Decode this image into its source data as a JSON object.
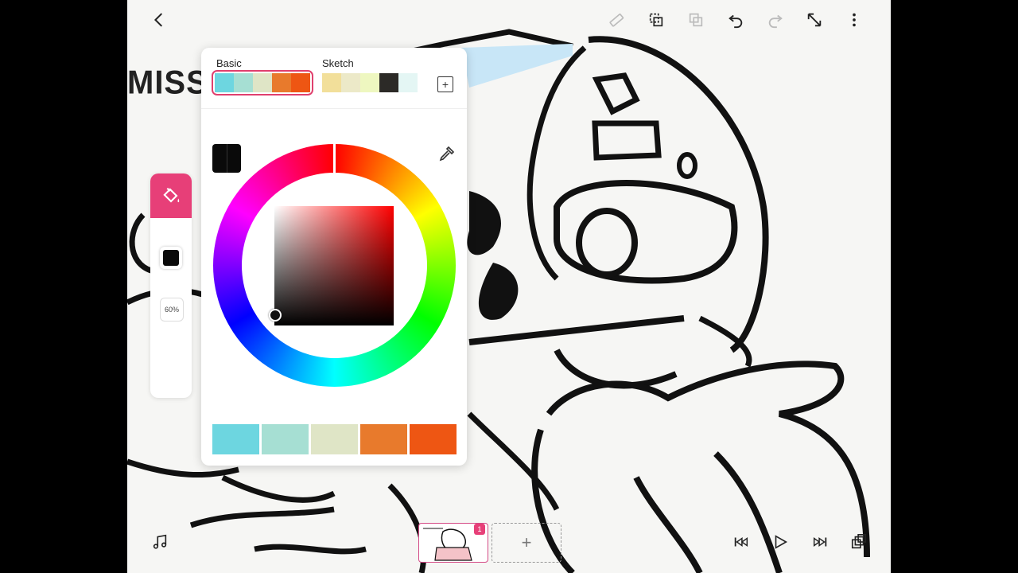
{
  "canvas": {
    "header_text": "MISS"
  },
  "palette_panel": {
    "palettes": [
      {
        "name": "Basic",
        "swatches": [
          "#6dd6e0",
          "#a6dfd3",
          "#dfe5c6",
          "#e87a2c",
          "#ee5613"
        ],
        "selected": true
      },
      {
        "name": "Sketch",
        "swatches": [
          "#f2df9a",
          "#ece9c8",
          "#eef7c0",
          "#2c2a27",
          "#e4f6f4"
        ],
        "selected": false
      }
    ],
    "add_palette_label": "+",
    "current_color": "#0a0a0a",
    "hue": "#ff0000",
    "recent_colors": [
      "#6dd6e0",
      "#a6dfd3",
      "#dfe5c6",
      "#e87a2c",
      "#ee5613"
    ]
  },
  "side_tool": {
    "tool_icon": "paint-bucket-icon",
    "accent": "#e73f78",
    "color": "#0a0a0a",
    "opacity_label": "60%"
  },
  "timeline": {
    "frame_badge": "1",
    "add_frame_label": "+"
  },
  "toolbar": {
    "icons": [
      "back-icon",
      "ruler-icon",
      "copy-icon",
      "paste-icon",
      "undo-icon",
      "redo-icon",
      "expand-icon",
      "more-icon"
    ]
  },
  "bottom_controls": {
    "icons": [
      "music-icon",
      "rewind-icon",
      "play-icon",
      "fast-forward-icon",
      "layers-icon"
    ]
  }
}
